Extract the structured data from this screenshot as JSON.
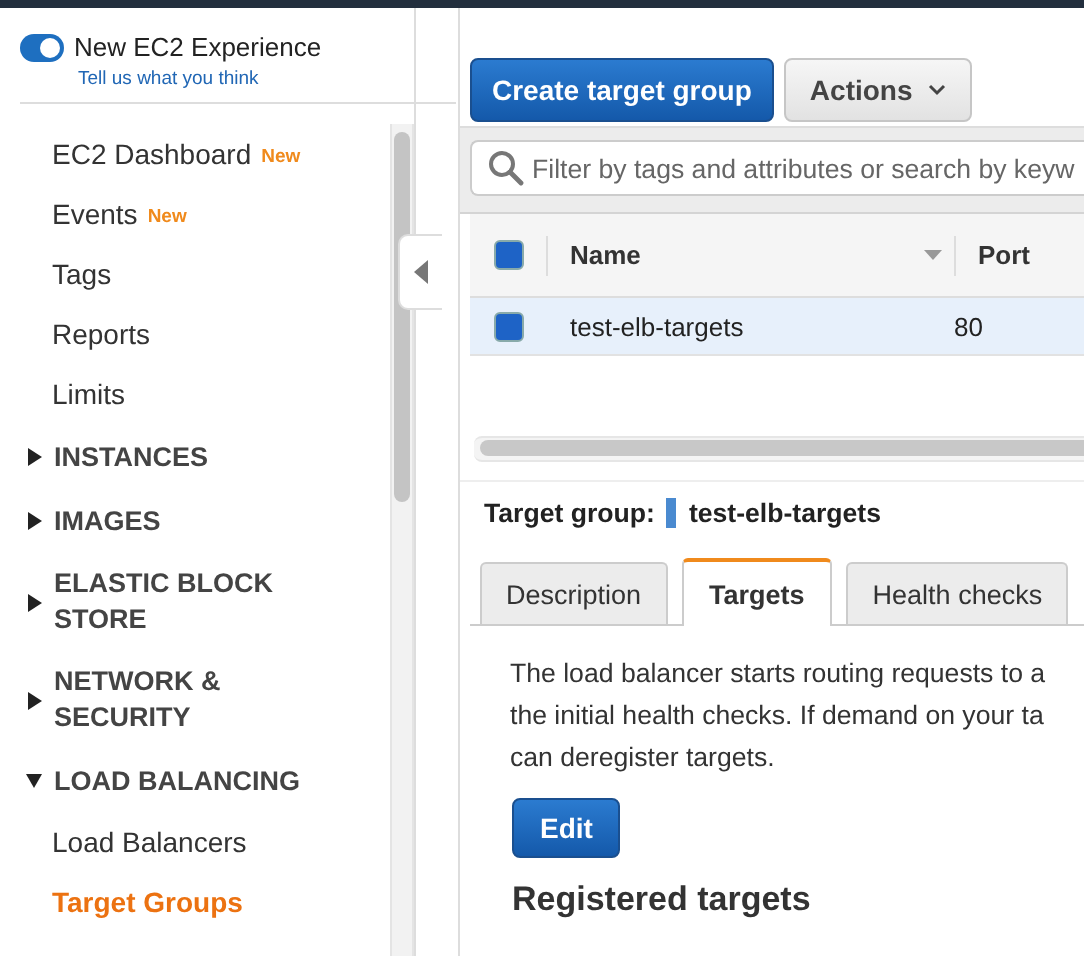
{
  "experience_toggle": {
    "label": "New EC2 Experience",
    "on": true,
    "link": "Tell us what you think"
  },
  "nav": [
    {
      "kind": "link",
      "label": "EC2 Dashboard",
      "badge": "New",
      "selected": false
    },
    {
      "kind": "link",
      "label": "Events",
      "badge": "New",
      "selected": false
    },
    {
      "kind": "link",
      "label": "Tags",
      "selected": false
    },
    {
      "kind": "link",
      "label": "Reports",
      "selected": false
    },
    {
      "kind": "link",
      "label": "Limits",
      "selected": false
    },
    {
      "kind": "section",
      "label": "INSTANCES",
      "expanded": false
    },
    {
      "kind": "section",
      "label": "IMAGES",
      "expanded": false
    },
    {
      "kind": "section",
      "label": "ELASTIC BLOCK STORE",
      "expanded": false
    },
    {
      "kind": "section",
      "label": "NETWORK & SECURITY",
      "expanded": false
    },
    {
      "kind": "section",
      "label": "LOAD BALANCING",
      "expanded": true,
      "children": [
        {
          "kind": "link",
          "label": "Load Balancers",
          "selected": false
        },
        {
          "kind": "link",
          "label": "Target Groups",
          "selected": true
        }
      ]
    }
  ],
  "actions": [
    {
      "kind": "primary",
      "label": "Create target group"
    },
    {
      "kind": "menu",
      "label": "Actions"
    }
  ],
  "filter": {
    "placeholder": "Filter by tags and attributes or search by keyw"
  },
  "table": {
    "header_checkbox": {
      "checked": true
    },
    "columns": [
      {
        "label": "Name",
        "sortable": true
      },
      {
        "label": "Port",
        "sortable": false
      }
    ],
    "rows": [
      {
        "cells": [
          "test-elb-targets",
          "80"
        ],
        "selected": true,
        "checked": true
      }
    ]
  },
  "detail": {
    "label": "Target group:",
    "name": "test-elb-targets",
    "tabs": [
      {
        "label": "Description",
        "selected": false
      },
      {
        "label": "Targets",
        "selected": true
      },
      {
        "label": "Health checks",
        "selected": false
      }
    ],
    "paragraph_lines": [
      "The load balancer starts routing requests to a",
      "the initial health checks. If demand on your ta",
      "can deregister targets."
    ],
    "button": "Edit",
    "heading": "Registered targets"
  }
}
